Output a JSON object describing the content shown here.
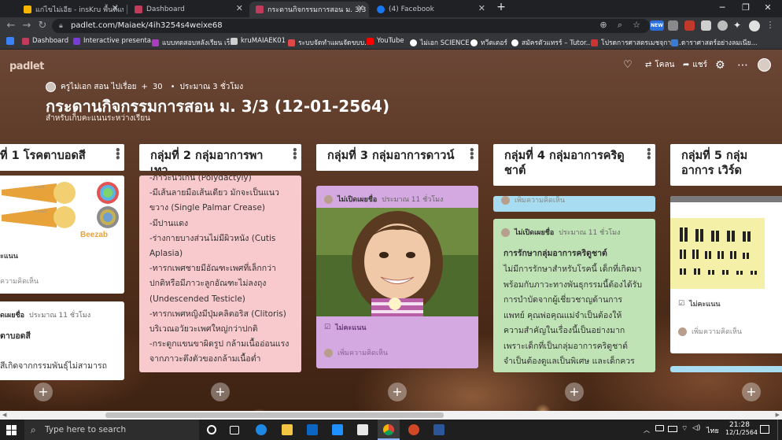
{
  "browser": {
    "tabs": [
      {
        "title": "แก่ไขไม่เอีย - insKru พื้นที่แบ่งปันไอเดี"
      },
      {
        "title": "Dashboard"
      },
      {
        "title": "กระดานกิจกรรมการสอน ม. 3/3 (12-0"
      },
      {
        "title": "(4) Facebook"
      }
    ],
    "close_glyph": "✕",
    "new_tab": "+",
    "window_controls": {
      "min": "─",
      "max": "❐",
      "close": "✕"
    },
    "url": "padlet.com/Maiaek/4ih3254s4weixe68",
    "bookmarks": [
      {
        "label": "Dashboard",
        "color": "#c13b5a"
      },
      {
        "label": "Interactive presenta...",
        "color": "#7a3bd9"
      },
      {
        "label": "แบบทดสอบหลังเรียน เร็...",
        "color": "#a93fc0"
      },
      {
        "label": "kruMAIAEK01",
        "color": "#cfcfcf"
      },
      {
        "label": "ระบบจัดทำแผนจัดขบบ...",
        "color": "#e04848"
      },
      {
        "label": "YouTube",
        "color": "#ff0000"
      },
      {
        "label": "ไม่เอก SCIENCE",
        "color": "#ffffff"
      },
      {
        "label": "ทวีตเตอร์",
        "color": "#ffffff"
      },
      {
        "label": "สมัครตัวแทรร์ – Tutor...",
        "color": "#ffffff"
      },
      {
        "label": "โปรดการศาสตรเมชจฺการ...",
        "color": "#cc3333"
      },
      {
        "label": "ดาราศาสตร์อย่างลมเนีย...",
        "color": "#3a7bd5"
      }
    ],
    "new_badge": "NEW"
  },
  "padlet": {
    "logo": "padlet",
    "top_actions": {
      "remake": "โคลน",
      "share": "แชร์"
    },
    "author": "ครูไม่เอก สอน ไปเรื่อย",
    "likes": "30",
    "time": "ประมาณ 3 ชั่วโมง",
    "title": "กระดานกิจกรรมการสอน ม. 3/3 (12-01-2564)",
    "subtitle": "สำหรับเก็บคะแนนระหว่างเรียน",
    "columns": [
      {
        "header": "ที่ 1 โรคตาบอดสี",
        "cards": [
          {
            "image": "color-blind-eyes",
            "brand": "Beezab",
            "eye_label_1": "ตาปกติ",
            "eye_label_2": "ตาบอดสี",
            "footer": "ะแนน",
            "comment": "ความคิดเห็น"
          },
          {
            "author": "ดเผยชื่อ",
            "time": "ประมาณ 11 ชั่วโมง",
            "title": "ตาบอดสี",
            "body": "สีเกิดจากกรรมพันธุ์ไม่สามารถ"
          }
        ]
      },
      {
        "header": "กลุ่มที่ 2 กลุ่มอาการพาเทา",
        "cards": [
          {
            "lines": [
              "-ภาวะนิ้วเกิน (Polydactyly)",
              "-มีเส้นลายมือเส้นเดียว มักจะเป็นแนว",
              "ขวาง (Single Palmar Crease)",
              "-มีปานแดง",
              "-ร่างกายบางส่วนไม่มีผิวหนัง (Cutis",
              "Aplasia)",
              "-ทารกเพศชายมีอัณฑะเพศที่เล็กกว่า",
              "ปกติหรือมีภาวะลูกอัณฑะไม่ลงถุง",
              "(Undescended Testicle)",
              "-ทารกเพศหญิงมีปุ่มคลิตอริส (Clitoris)",
              "บริเวณอวัยวะเพศใหญ่กว่าปกติ",
              "-กระดูกแขนขาผิดรูป กล้ามเนื้ออ่อนแรง",
              "จากภาวะตึงตัวของกล้ามเนื้อต่ำ"
            ]
          }
        ]
      },
      {
        "header": "กลุ่มที่ 3 กลุ่มอาการดาวน์",
        "cards": [
          {
            "author": "ไม่เปิดเผยชื่อ",
            "time": "ประมาณ 11 ชั่วโมง",
            "image": "smiling-girl-photo",
            "footer": "ไม่คะแนน",
            "comment": "เพิ่มความคิดเห็น"
          }
        ]
      },
      {
        "header": "กลุ่มที่ 4 กลุ่มอาการคริดูชาต์",
        "cards": [
          {
            "comment": "เพิ่มความคิดเห็น"
          },
          {
            "author": "ไม่เปิดเผยชื่อ",
            "time": "ประมาณ 11 ชั่วโมง",
            "title": "การรักษากลุ่มอาการคริดูชาต์",
            "lines": [
              "ไม่มีการรักษาสำหรับโรคนี้ เด็กที่เกิดมา",
              "พร้อมกับภาวะทางพันธุกรรมนี้ต้องได้รับ",
              "การบำบัดจากผู้เชี่ยวชาญด้านการ",
              "แพทย์ คุณพ่อคุณแม่จำเป็นต้องให้",
              "ความสำคัญในเรื่องนี้เป็นอย่างมาก",
              "เพราะเด็กที่เป็นกลุ่มอาการคริดูชาต์",
              "จำเป็นต้องดูแลเป็นพิเศษ และเด็กควร"
            ]
          }
        ]
      },
      {
        "header": "กลุ่มที่ 5 กลุ่มอาการ เวิร์ด",
        "cards": [
          {
            "image": "karyotype-chart",
            "footer": "ไม่คะแนน",
            "comment": "เพิ่มความคิดเห็น"
          }
        ]
      }
    ],
    "add_glyph": "+"
  },
  "taskbar": {
    "search_placeholder": "Type here to search",
    "time": "21:28",
    "date": "12/1/2564",
    "lang": "ไทย"
  }
}
